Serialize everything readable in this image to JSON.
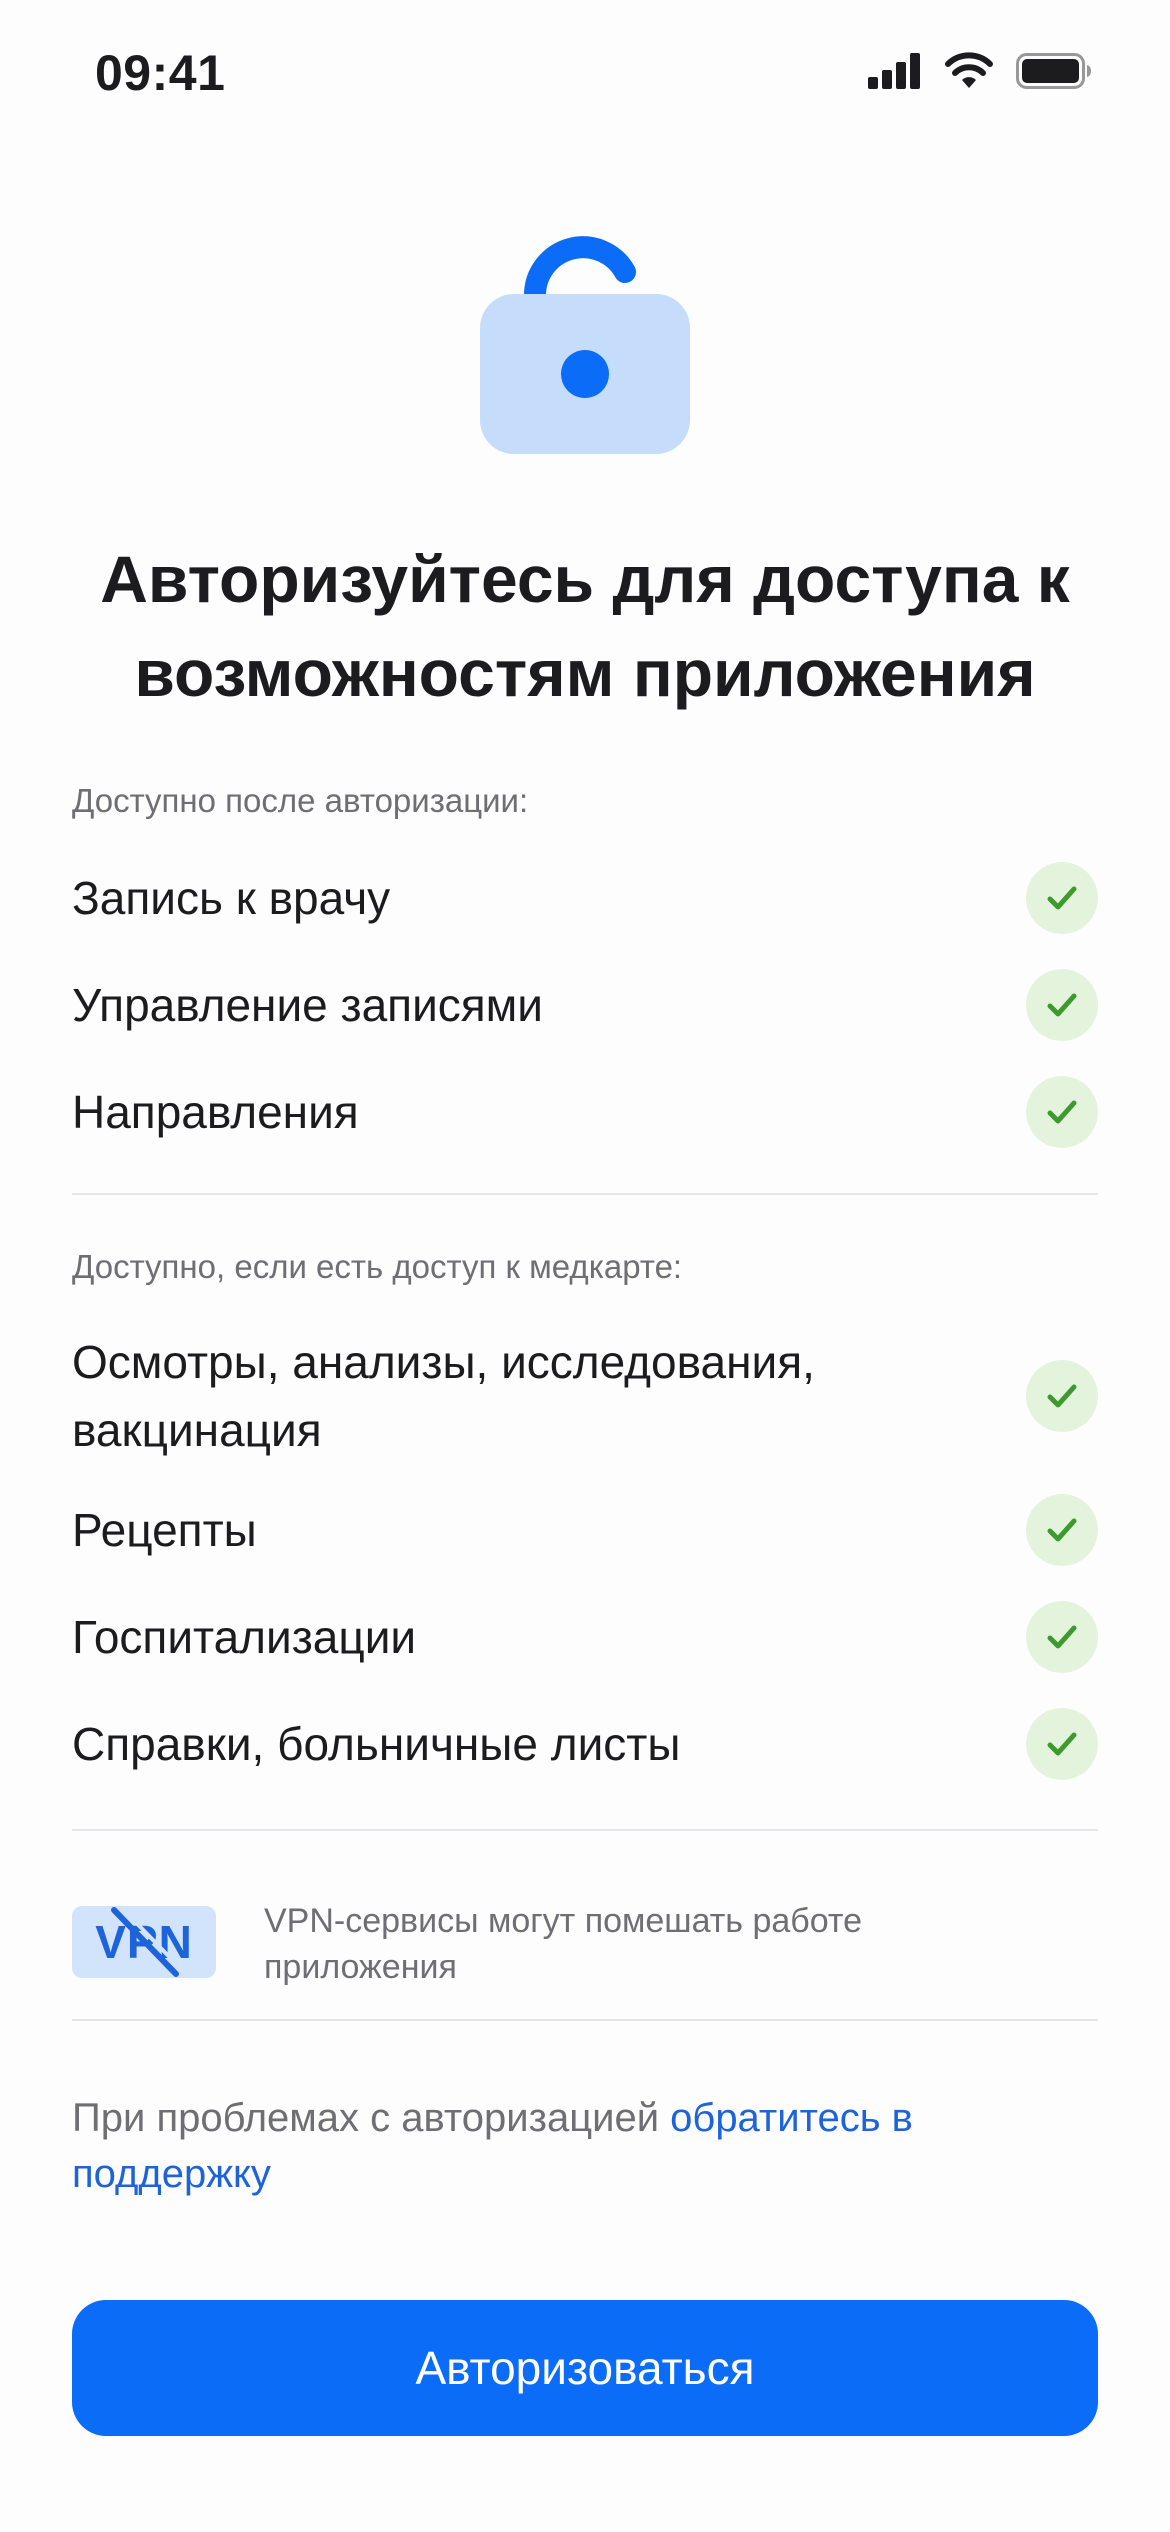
{
  "status_bar": {
    "time": "09:41"
  },
  "title": "Авторизуйтесь для доступа к возможностям приложения",
  "section_after_auth": {
    "caption": "Доступно после авторизации:",
    "items": [
      "Запись к врачу",
      "Управление записями",
      "Направления"
    ]
  },
  "section_medcard": {
    "caption": "Доступно, если есть доступ к медкарте:",
    "items": [
      "Осмотры, анализы, исследования, вакцинация",
      "Рецепты",
      "Госпитализации",
      "Справки, больничные листы"
    ]
  },
  "vpn": {
    "badge": "VPN",
    "note": "VPN-сервисы могут помешать работе приложения"
  },
  "support": {
    "text": "При проблемах с авторизацией ",
    "link": "обратитесь в поддержку"
  },
  "button": {
    "label": "Авторизоваться"
  },
  "colors": {
    "accent": "#0a6cf7",
    "check_bg": "#e4f4dc",
    "check_mark": "#3e9a2e",
    "lock_body": "#c5dcfb"
  },
  "icons": [
    "signal-icon",
    "wifi-icon",
    "battery-icon",
    "lock-open-icon",
    "check-icon",
    "vpn-icon"
  ]
}
